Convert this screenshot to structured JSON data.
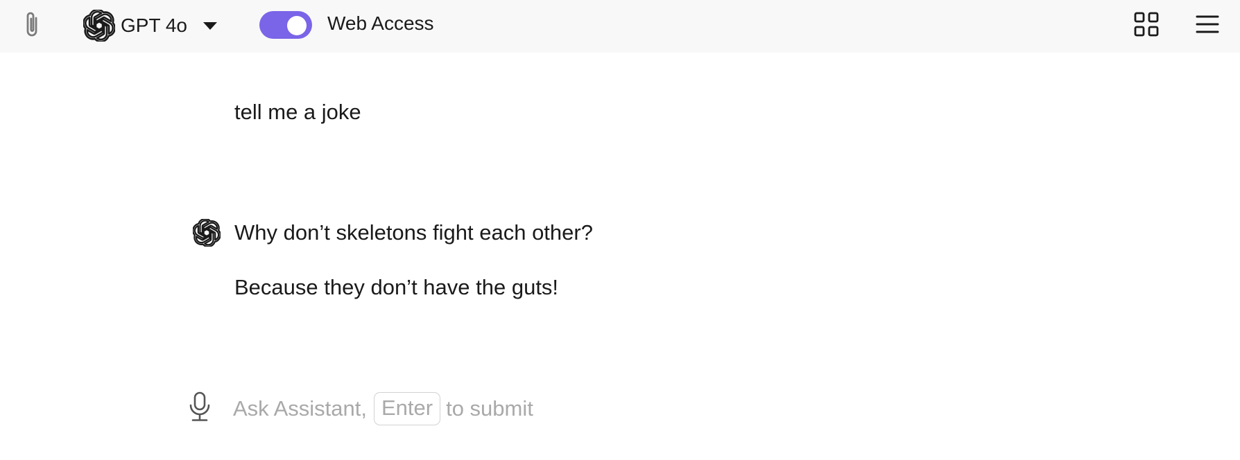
{
  "topbar": {
    "attach_icon": "paperclip-icon",
    "model": {
      "logo_icon": "openai-logo-icon",
      "name": "GPT 4o",
      "caret_icon": "caret-down-icon"
    },
    "web_access": {
      "enabled": true,
      "label": "Web Access",
      "accent_color": "#7a64e8"
    },
    "grid_icon": "grid-icon",
    "menu_icon": "hamburger-menu-icon"
  },
  "conversation": {
    "user_message": "tell me a joke",
    "assistant": {
      "avatar_icon": "openai-logo-icon",
      "lines": [
        "Why don’t skeletons fight each other?",
        "Because they don’t have the guts!"
      ]
    }
  },
  "composer": {
    "mic_icon": "microphone-icon",
    "placeholder_prefix": "Ask Assistant,",
    "enter_key": "Enter",
    "placeholder_suffix": "to submit"
  }
}
